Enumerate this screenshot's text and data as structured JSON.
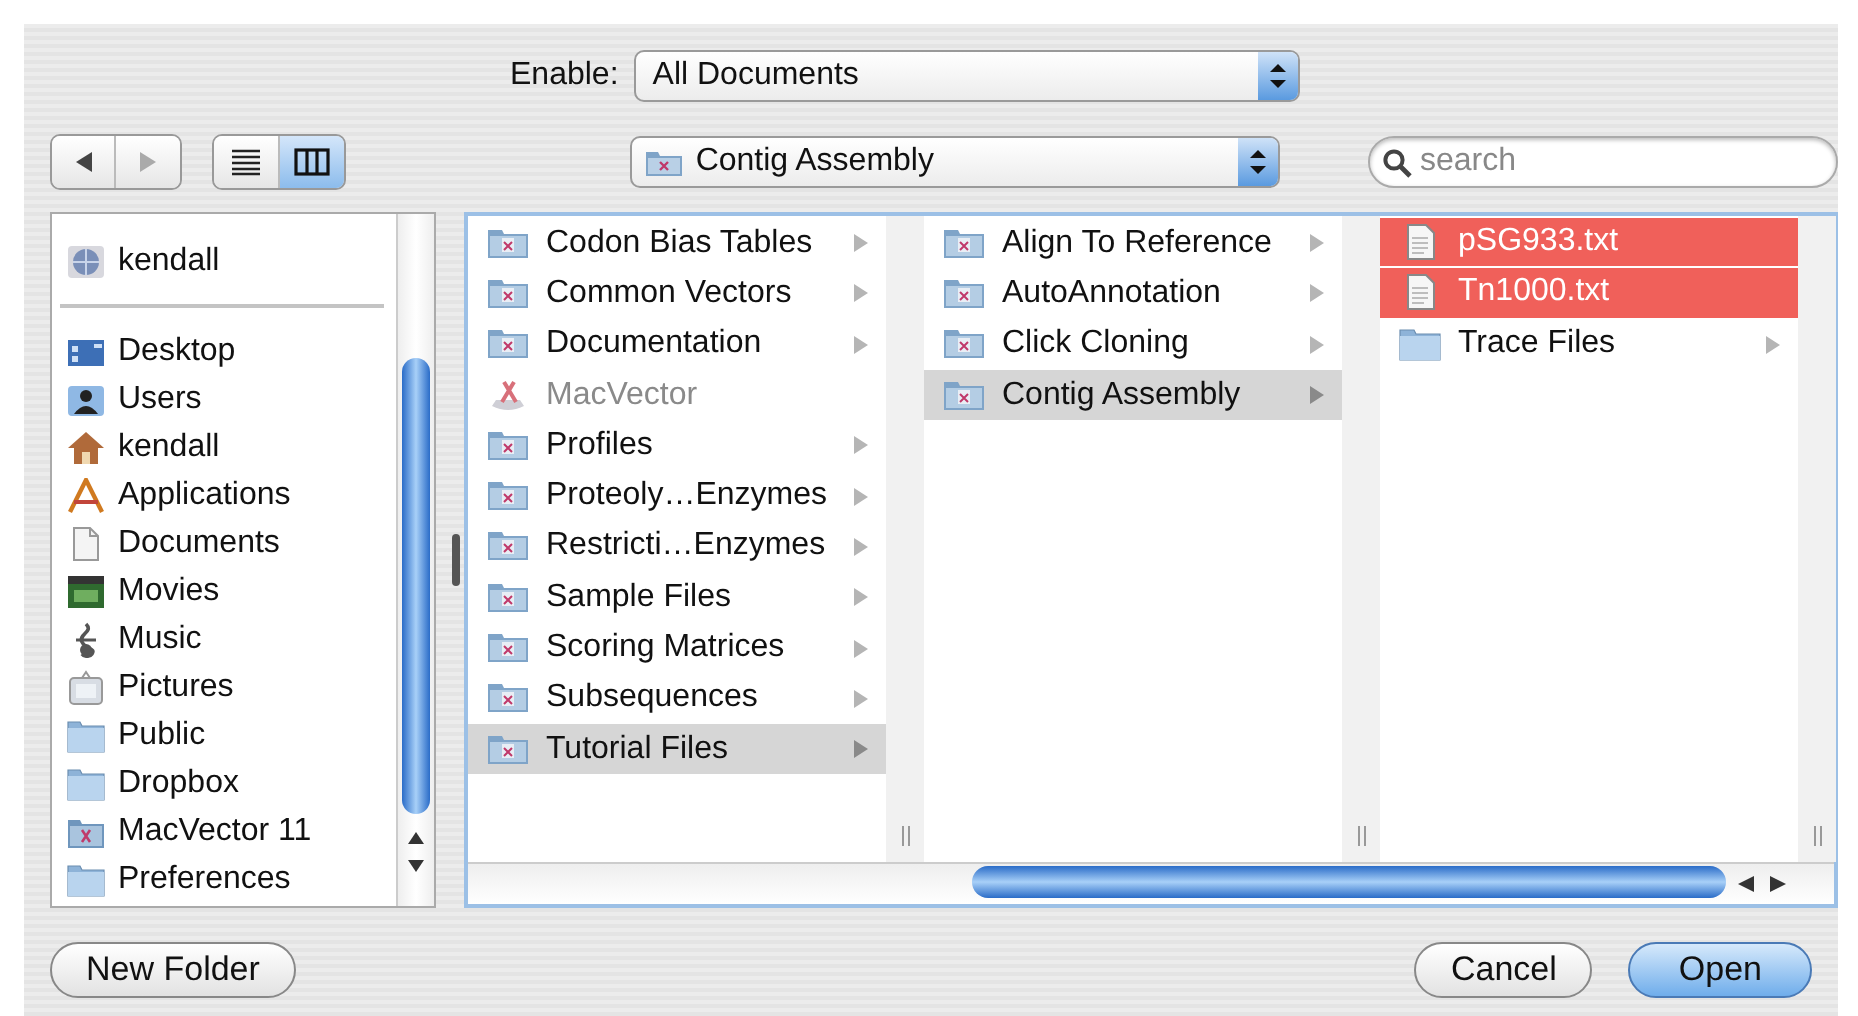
{
  "enable": {
    "label": "Enable:",
    "value": "All Documents"
  },
  "location": {
    "value": "Contig Assembly"
  },
  "view_modes": [
    {
      "kind": "list",
      "selected": false
    },
    {
      "kind": "columns",
      "selected": true
    }
  ],
  "search": {
    "placeholder": "search"
  },
  "sidebar": {
    "sections": [
      {
        "items": [
          {
            "label": "kendall",
            "kind": "network"
          }
        ]
      },
      {
        "items": [
          {
            "label": "Desktop",
            "kind": "desktop"
          },
          {
            "label": "Users",
            "kind": "users"
          },
          {
            "label": "kendall",
            "kind": "home"
          },
          {
            "label": "Applications",
            "kind": "apps"
          },
          {
            "label": "Documents",
            "kind": "docs"
          },
          {
            "label": "Movies",
            "kind": "movies"
          },
          {
            "label": "Music",
            "kind": "music"
          },
          {
            "label": "Pictures",
            "kind": "pictures"
          },
          {
            "label": "Public",
            "kind": "folder"
          },
          {
            "label": "Dropbox",
            "kind": "folder"
          },
          {
            "label": "MacVector 11",
            "kind": "appfolder"
          },
          {
            "label": "Preferences",
            "kind": "folder"
          }
        ]
      }
    ]
  },
  "columns": [
    {
      "active": false,
      "items": [
        {
          "label": "Codon Bias Tables",
          "kind": "folder",
          "selected": false,
          "disabled": false
        },
        {
          "label": "Common Vectors",
          "kind": "folder",
          "selected": false,
          "disabled": false
        },
        {
          "label": "Documentation",
          "kind": "folder",
          "selected": false,
          "disabled": false
        },
        {
          "label": "MacVector",
          "kind": "app",
          "selected": false,
          "disabled": true
        },
        {
          "label": "Profiles",
          "kind": "folder",
          "selected": false,
          "disabled": false
        },
        {
          "label": "Proteoly…Enzymes",
          "kind": "folder",
          "selected": false,
          "disabled": false
        },
        {
          "label": "Restricti…Enzymes",
          "kind": "folder",
          "selected": false,
          "disabled": false
        },
        {
          "label": "Sample Files",
          "kind": "folder",
          "selected": false,
          "disabled": false
        },
        {
          "label": "Scoring Matrices",
          "kind": "folder",
          "selected": false,
          "disabled": false
        },
        {
          "label": "Subsequences",
          "kind": "folder",
          "selected": false,
          "disabled": false
        },
        {
          "label": "Tutorial Files",
          "kind": "folder",
          "selected": true,
          "disabled": false
        }
      ]
    },
    {
      "active": false,
      "items": [
        {
          "label": "Align To Reference",
          "kind": "folder",
          "selected": false,
          "disabled": false
        },
        {
          "label": "AutoAnnotation",
          "kind": "folder",
          "selected": false,
          "disabled": false
        },
        {
          "label": "Click Cloning",
          "kind": "folder",
          "selected": false,
          "disabled": false
        },
        {
          "label": "Contig Assembly",
          "kind": "folder",
          "selected": true,
          "disabled": false
        }
      ]
    },
    {
      "active": true,
      "items": [
        {
          "label": "pSG933.txt",
          "kind": "file",
          "selected": true,
          "disabled": false
        },
        {
          "label": "Tn1000.txt",
          "kind": "file",
          "selected": true,
          "disabled": false
        },
        {
          "label": "Trace Files",
          "kind": "plainfolder",
          "selected": false,
          "disabled": false
        }
      ]
    }
  ],
  "buttons": [
    {
      "label": "New Folder",
      "kind": "plain"
    },
    {
      "label": "Cancel",
      "kind": "plain"
    },
    {
      "label": "Open",
      "kind": "default"
    }
  ]
}
